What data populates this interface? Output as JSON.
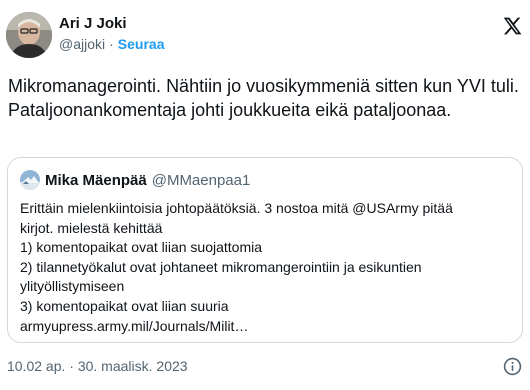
{
  "author": {
    "display_name": "Ari J Joki",
    "handle": "@ajjoki",
    "separator": "·",
    "follow_label": "Seuraa"
  },
  "tweet": {
    "text": "Mikromanagerointi. Nähtiin jo vuosikymmeniä sitten kun YVI tuli. Pataljoonankomentaja johti joukkueita eikä pataljoonaa."
  },
  "quote": {
    "display_name": "Mika Mäenpää",
    "handle": "@MMaenpaa1",
    "lines": [
      "Erittäin mielenkiintoisia johtopäätöksiä. 3 nostoa mitä @USArmy pitää",
      "kirjot. mielestä kehittää",
      "1) komentopaikat ovat liian suojattomia",
      "2) tilannetyökalut ovat johtaneet mikromangerointiin ja esikuntien",
      "ylityöllistymiseen",
      "3) komentopaikat ovat liian suuria",
      "armyupress.army.mil/Journals/Milit…"
    ]
  },
  "footer": {
    "timestamp": "10.02 ap. · 30. maalisk. 2023"
  },
  "icons": {
    "platform_logo": "x-logo-icon",
    "info": "info-icon"
  },
  "colors": {
    "link": "#1d9bf0",
    "secondary_text": "#536471",
    "border": "#cfd9de"
  }
}
